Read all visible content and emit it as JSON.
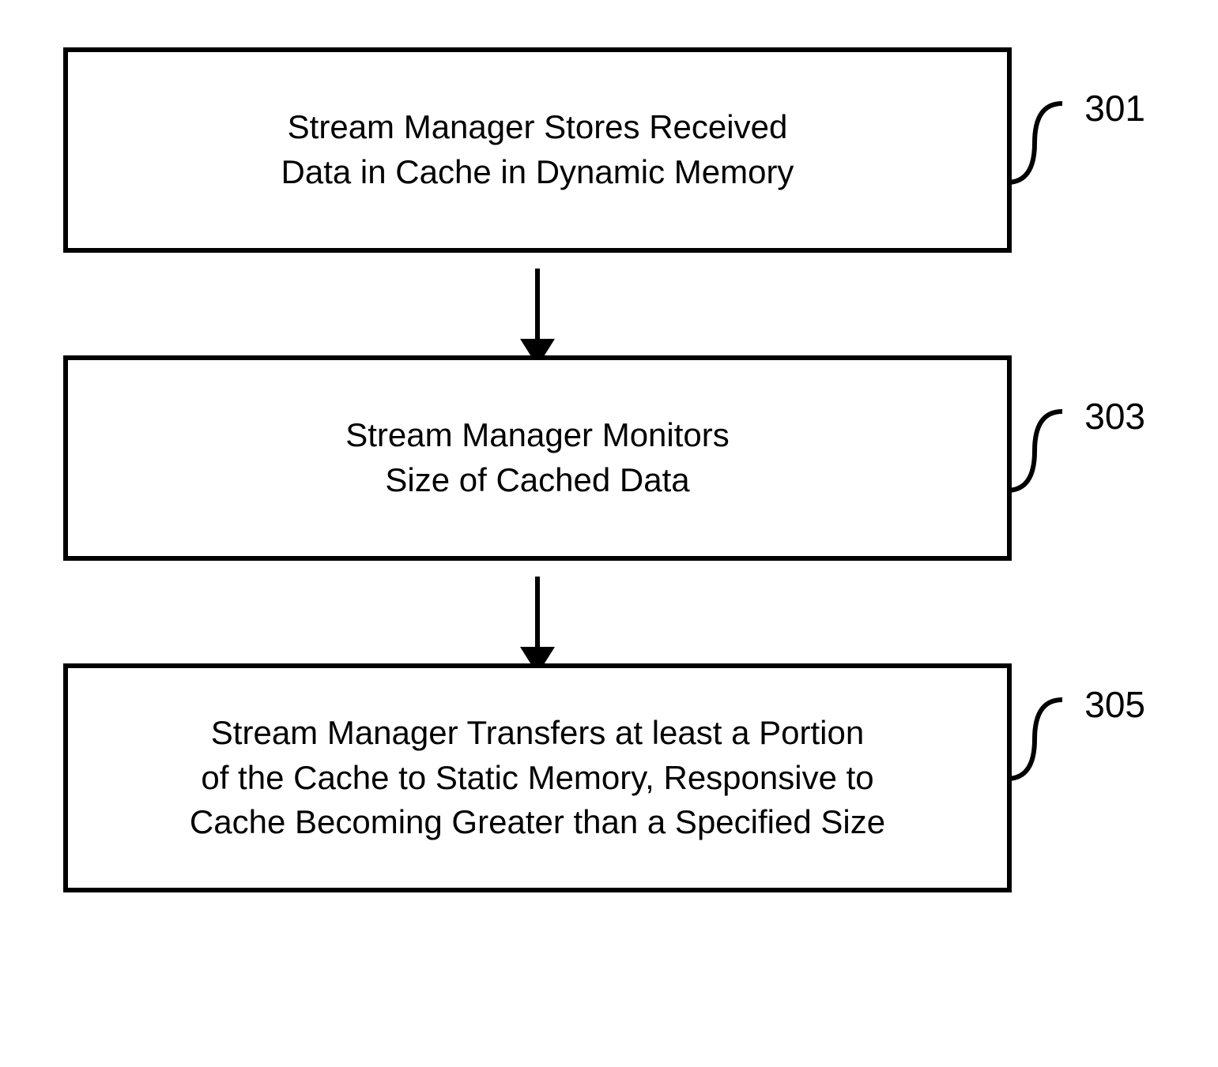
{
  "flowchart": {
    "steps": [
      {
        "id": "301",
        "text": "Stream Manager Stores Received\nData in Cache in Dynamic Memory"
      },
      {
        "id": "303",
        "text": "Stream Manager Monitors\nSize of Cached Data"
      },
      {
        "id": "305",
        "text": "Stream Manager Transfers at least a Portion\nof the Cache to Static Memory, Responsive to\nCache Becoming Greater than a Specified Size"
      }
    ]
  }
}
